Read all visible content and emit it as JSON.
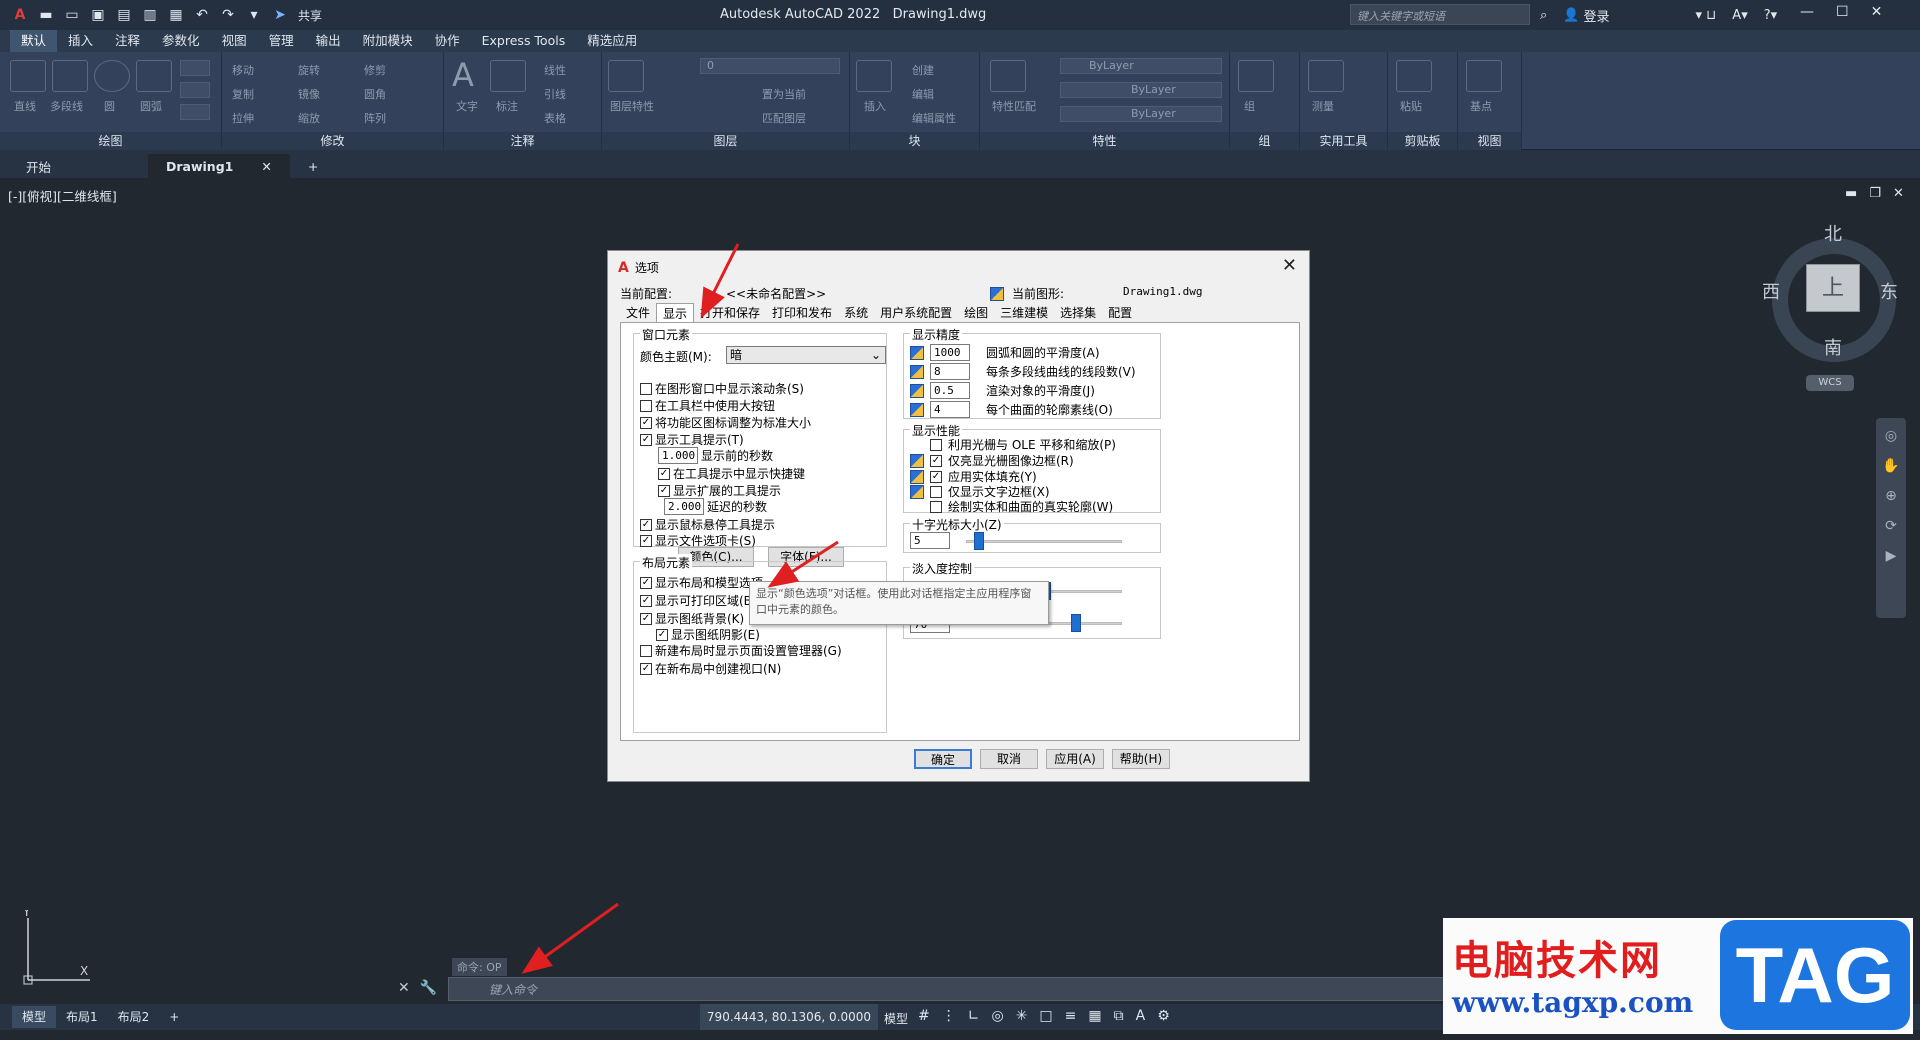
{
  "title_bar": {
    "app_title": "Autodesk AutoCAD 2022",
    "doc_title": "Drawing1.dwg",
    "share": "共享",
    "search_placeholder": "键入关键字或短语",
    "login": "登录"
  },
  "menus": [
    "默认",
    "插入",
    "注释",
    "参数化",
    "视图",
    "管理",
    "输出",
    "附加模块",
    "协作",
    "Express Tools",
    "精选应用"
  ],
  "ribbon": {
    "draw": {
      "title": "绘图",
      "items": [
        "直线",
        "多段线",
        "圆",
        "圆弧"
      ],
      "small": [
        "移动",
        "旋转",
        "修剪",
        "复制",
        "镜像",
        "圆角",
        "拉伸",
        "缩放",
        "阵列"
      ]
    },
    "modify_title": "修改",
    "annot": {
      "title": "注释",
      "items": [
        "文字",
        "标注"
      ],
      "small": [
        "线性",
        "引线",
        "表格"
      ]
    },
    "layers": {
      "title": "图层",
      "items": [
        "图层特性"
      ],
      "small": [
        "置为当前",
        "匹配图层"
      ],
      "layer_value": "0"
    },
    "block": {
      "title": "块",
      "items": [
        "插入"
      ],
      "small": [
        "创建",
        "编辑",
        "编辑属性"
      ]
    },
    "props": {
      "title": "特性",
      "items": [
        "特性匹配"
      ],
      "bylayer": [
        "ByLayer",
        "ByLayer",
        "ByLayer"
      ]
    },
    "groups": {
      "title": "组",
      "items": [
        "组"
      ]
    },
    "utils": {
      "title": "实用工具",
      "items": [
        "测量"
      ]
    },
    "clip": {
      "title": "剪贴板",
      "items": [
        "粘贴"
      ]
    },
    "view": {
      "title": "视图",
      "items": [
        "基点"
      ]
    }
  },
  "doc_tabs": {
    "start": "开始",
    "drawing": "Drawing1"
  },
  "viewport_label": "[-][俯视][二维线框]",
  "viewcube": {
    "n": "北",
    "s": "南",
    "e": "东",
    "w": "西",
    "top": "上",
    "wcs": "WCS"
  },
  "command": {
    "history": "命令: OP",
    "placeholder": "键入命令"
  },
  "status": {
    "layouts": [
      "模型",
      "布局1",
      "布局2"
    ],
    "coords": "790.4443, 80.1306, 0.0000",
    "model": "模型"
  },
  "watermark": {
    "cn": "电脑技术网",
    "url": "www.tagxp.com",
    "tag": "TAG"
  },
  "dialog": {
    "title": "选项",
    "profile_label": "当前配置:",
    "profile_value": "<<未命名配置>>",
    "drawing_label": "当前图形:",
    "drawing_value": "Drawing1.dwg",
    "tabs": [
      "文件",
      "显示",
      "打开和保存",
      "打印和发布",
      "系统",
      "用户系统配置",
      "绘图",
      "三维建模",
      "选择集",
      "配置"
    ],
    "window_elements": {
      "title": "窗口元素",
      "theme_label": "颜色主题(M):",
      "theme_value": "暗",
      "checks": [
        {
          "label": "在图形窗口中显示滚动条(S)",
          "checked": false
        },
        {
          "label": "在工具栏中使用大按钮",
          "checked": false
        },
        {
          "label": "将功能区图标调整为标准大小",
          "checked": true
        },
        {
          "label": "显示工具提示(T)",
          "checked": true
        }
      ],
      "tip_delay": "1.000",
      "tip_delay_label": "显示前的秒数",
      "show_shortcut": "在工具提示中显示快捷键",
      "show_ext": "显示扩展的工具提示",
      "ext_delay": "2.000",
      "ext_delay_label": "延迟的秒数",
      "rollover": "显示鼠标悬停工具提示",
      "file_tabs": "显示文件选项卡(S)",
      "colors_btn": "颜色(C)...",
      "fonts_btn": "字体(F)..."
    },
    "layout_elements": {
      "title": "布局元素",
      "checks": [
        {
          "label": "显示布局和模型选项",
          "checked": true
        },
        {
          "label": "显示可打印区域(B)",
          "checked": true
        },
        {
          "label": "显示图纸背景(K)",
          "checked": true
        },
        {
          "label": "显示图纸阴影(E)",
          "checked": true
        },
        {
          "label": "新建布局时显示页面设置管理器(G)",
          "checked": false
        },
        {
          "label": "在新布局中创建视口(N)",
          "checked": true
        }
      ]
    },
    "tooltip": "显示“颜色选项”对话框。使用此对话框指定主应用程序窗口中元素的颜色。",
    "resolution": {
      "title": "显示精度",
      "rows": [
        {
          "value": "1000",
          "label": "圆弧和圆的平滑度(A)"
        },
        {
          "value": "8",
          "label": "每条多段线曲线的线段数(V)"
        },
        {
          "value": "0.5",
          "label": "渲染对象的平滑度(J)"
        },
        {
          "value": "4",
          "label": "每个曲面的轮廓素线(O)"
        }
      ]
    },
    "performance": {
      "title": "显示性能",
      "rows": [
        {
          "label": "利用光栅与 OLE 平移和缩放(P)",
          "checked": false
        },
        {
          "label": "仅亮显光栅图像边框(R)",
          "checked": true
        },
        {
          "label": "应用实体填充(Y)",
          "checked": true
        },
        {
          "label": "仅显示文字边框(X)",
          "checked": false
        },
        {
          "label": "绘制实体和曲面的真实轮廓(W)",
          "checked": false
        }
      ]
    },
    "crosshair": {
      "title": "十字光标大小(Z)",
      "value": "5",
      "level": 0.05
    },
    "fade": {
      "title": "淡入度控制",
      "value2": "70",
      "level1": 0.5,
      "level2": 0.7
    },
    "buttons": {
      "ok": "确定",
      "cancel": "取消",
      "apply": "应用(A)",
      "help": "帮助(H)"
    }
  }
}
